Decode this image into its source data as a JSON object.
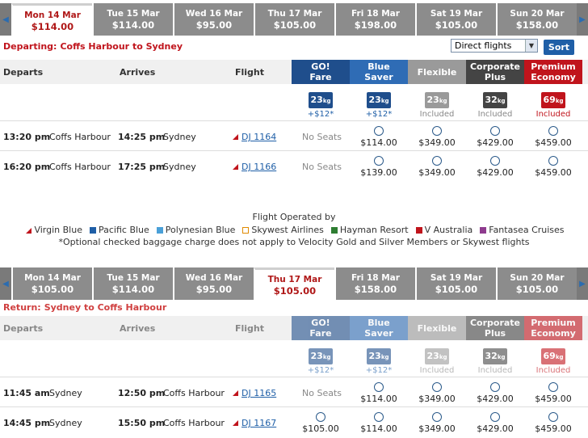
{
  "outbound": {
    "dates": [
      {
        "day": "Mon 14 Mar",
        "price": "$114.00",
        "selected": true
      },
      {
        "day": "Tue 15 Mar",
        "price": "$114.00"
      },
      {
        "day": "Wed 16 Mar",
        "price": "$95.00"
      },
      {
        "day": "Thu 17 Mar",
        "price": "$105.00"
      },
      {
        "day": "Fri 18 Mar",
        "price": "$198.00"
      },
      {
        "day": "Sat 19 Mar",
        "price": "$105.00"
      },
      {
        "day": "Sun 20 Mar",
        "price": "$158.00"
      }
    ],
    "route_label": "Departing:",
    "route": "Coffs Harbour to Sydney",
    "flights": [
      {
        "dep_time": "13:20 pm",
        "dep_city": "Coffs Harbour",
        "arr_time": "14:25 pm",
        "arr_city": "Sydney",
        "flight": "DJ 1164",
        "go": "No Seats",
        "prices": [
          "$114.00",
          "$349.00",
          "$429.00",
          "$459.00"
        ]
      },
      {
        "dep_time": "16:20 pm",
        "dep_city": "Coffs Harbour",
        "arr_time": "17:25 pm",
        "arr_city": "Sydney",
        "flight": "DJ 1166",
        "go": "No Seats",
        "prices": [
          "$139.00",
          "$349.00",
          "$429.00",
          "$459.00"
        ]
      }
    ]
  },
  "return": {
    "dates": [
      {
        "day": "Mon 14 Mar",
        "price": "$105.00"
      },
      {
        "day": "Tue 15 Mar",
        "price": "$114.00"
      },
      {
        "day": "Wed 16 Mar",
        "price": "$95.00"
      },
      {
        "day": "Thu 17 Mar",
        "price": "$105.00",
        "selected": true
      },
      {
        "day": "Fri 18 Mar",
        "price": "$158.00"
      },
      {
        "day": "Sat 19 Mar",
        "price": "$105.00"
      },
      {
        "day": "Sun 20 Mar",
        "price": "$105.00"
      }
    ],
    "route_label": "Return:",
    "route": "Sydney to Coffs Harbour",
    "flights": [
      {
        "dep_time": "11:45 am",
        "dep_city": "Sydney",
        "arr_time": "12:50 pm",
        "arr_city": "Coffs Harbour",
        "flight": "DJ 1165",
        "go": "No Seats",
        "prices": [
          "$114.00",
          "$349.00",
          "$429.00",
          "$459.00"
        ]
      },
      {
        "dep_time": "14:45 pm",
        "dep_city": "Sydney",
        "arr_time": "15:50 pm",
        "arr_city": "Coffs Harbour",
        "flight": "DJ 1167",
        "go": "$105.00",
        "prices": [
          "$114.00",
          "$349.00",
          "$429.00",
          "$459.00"
        ]
      }
    ]
  },
  "filter": {
    "value": "Direct flights"
  },
  "sort_label": "Sort",
  "columns": {
    "departs": "Departs",
    "arrives": "Arrives",
    "flight": "Flight"
  },
  "fares": [
    {
      "name1": "GO!",
      "name2": "Fare",
      "color": "#1f4e8c",
      "bag": "23",
      "bag_color": "#1f4e8c",
      "note": "+$12*"
    },
    {
      "name1": "Blue",
      "name2": "Saver",
      "color": "#2f6cb5",
      "bag": "23",
      "bag_color": "#1f4e8c",
      "note": "+$12*"
    },
    {
      "name1": "Flexible",
      "name2": "",
      "color": "#9a9a9a",
      "bag": "23",
      "bag_color": "#9a9a9a",
      "note": "Included"
    },
    {
      "name1": "Corporate",
      "name2": "Plus",
      "color": "#444444",
      "bag": "32",
      "bag_color": "#444444",
      "note": "Included"
    },
    {
      "name1": "Premium",
      "name2": "Economy",
      "color": "#c0141c",
      "bag": "69",
      "bag_color": "#c0141c",
      "note": "Included"
    }
  ],
  "bag_unit": "kg",
  "legend": {
    "title": "Flight Operated by",
    "operators": [
      {
        "name": "Virgin Blue",
        "color": "#c0141c"
      },
      {
        "name": "Pacific Blue",
        "color": "#1f5fa7"
      },
      {
        "name": "Polynesian Blue",
        "color": "#4aa0d8"
      },
      {
        "name": "Skywest Airlines",
        "color": "#e08a00"
      },
      {
        "name": "Hayman Resort",
        "color": "#2e7d32"
      },
      {
        "name": "V Australia",
        "color": "#c0141c"
      },
      {
        "name": "Fantasea Cruises",
        "color": "#8e3b8e"
      }
    ],
    "note": "*Optional checked baggage charge does not apply to Velocity Gold and Silver Members or Skywest flights"
  }
}
